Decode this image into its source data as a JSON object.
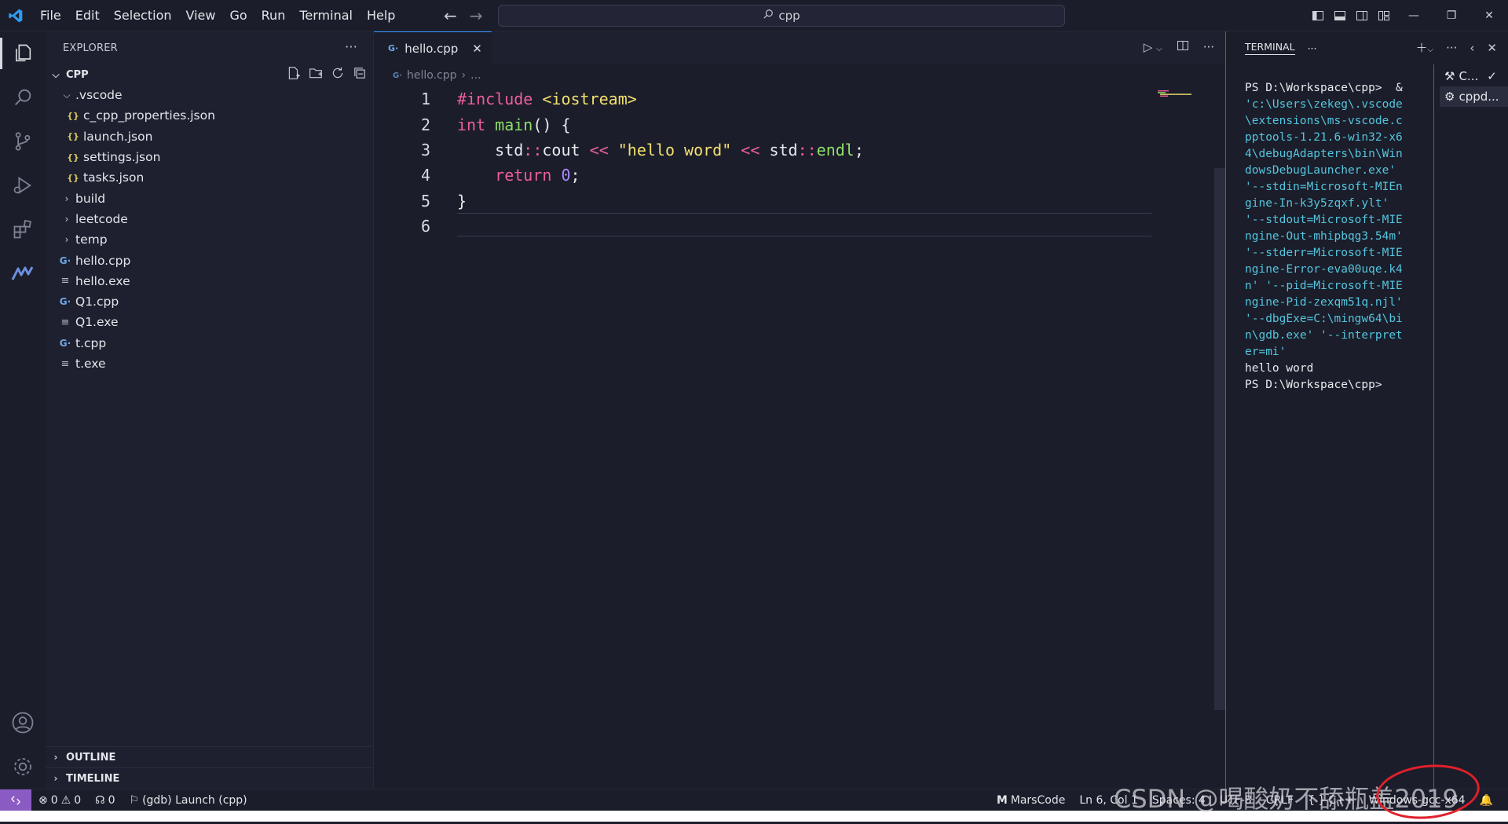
{
  "titlebar": {
    "menu": [
      "File",
      "Edit",
      "Selection",
      "View",
      "Go",
      "Run",
      "Terminal",
      "Help"
    ],
    "search": "cpp"
  },
  "explorer": {
    "title": "EXPLORER",
    "folder": "CPP",
    "items": [
      {
        "label": ".vscode",
        "type": "folder-open",
        "depth": 1
      },
      {
        "label": "c_cpp_properties.json",
        "type": "json",
        "depth": 2
      },
      {
        "label": "launch.json",
        "type": "json",
        "depth": 2
      },
      {
        "label": "settings.json",
        "type": "json",
        "depth": 2
      },
      {
        "label": "tasks.json",
        "type": "json",
        "depth": 2
      },
      {
        "label": "build",
        "type": "folder",
        "depth": 1
      },
      {
        "label": "leetcode",
        "type": "folder",
        "depth": 1
      },
      {
        "label": "temp",
        "type": "folder",
        "depth": 1
      },
      {
        "label": "hello.cpp",
        "type": "cpp",
        "depth": 1
      },
      {
        "label": "hello.exe",
        "type": "exe",
        "depth": 1
      },
      {
        "label": "Q1.cpp",
        "type": "cpp",
        "depth": 1
      },
      {
        "label": "Q1.exe",
        "type": "exe",
        "depth": 1
      },
      {
        "label": "t.cpp",
        "type": "cpp",
        "depth": 1
      },
      {
        "label": "t.exe",
        "type": "exe",
        "depth": 1
      }
    ],
    "outline": "OUTLINE",
    "timeline": "TIMELINE"
  },
  "editor": {
    "tab": "hello.cpp",
    "breadcrumb": "hello.cpp",
    "breadcrumb_more": "...",
    "line_numbers": [
      "1",
      "2",
      "3",
      "4",
      "5",
      "6"
    ]
  },
  "terminal": {
    "title": "TERMINAL",
    "output_prompt": "PS D:\\Workspace\\cpp>  & ",
    "output_cmd": "'c:\\Users\\zekeg\\.vscode\\extensions\\ms-vscode.cpptools-1.21.6-win32-x64\\debugAdapters\\bin\\WindowsDebugLauncher.exe' '--stdin=Microsoft-MIEngine-In-k3y5zqxf.ylt' '--stdout=Microsoft-MIEngine-Out-mhipbqg3.54m' '--stderr=Microsoft-MIEngine-Error-eva00uqe.k4n' '--pid=Microsoft-MIEngine-Pid-zexqm51q.njl' '--dbgExe=C:\\mingw64\\bin\\gdb.exe' '--interpreter=mi'",
    "output_result": "hello word",
    "output_prompt_end": "PS D:\\Workspace\\cpp>",
    "sessions": [
      "C...",
      "cppd..."
    ]
  },
  "statusbar": {
    "errors": "0",
    "warnings": "0",
    "ports": "0",
    "launch": "(gdb) Launch (cpp)",
    "marscode": "MarsCode",
    "position": "Ln 6, Col 1",
    "spaces": "Spaces: 4",
    "encoding": "UTF-8",
    "eol": "CRLF",
    "language": "C++",
    "platform": "Windows-gcc-x64"
  },
  "watermark": "CSDN @喝酸奶不舔瓶盖2019",
  "colors": {
    "accent": "#3794ff",
    "remote": "#8b5bc4",
    "keyword": "#ec5f9b",
    "string": "#f3e06f",
    "function": "#8ee06a",
    "number": "#a78bfa",
    "terminal_path": "#54c5de"
  }
}
